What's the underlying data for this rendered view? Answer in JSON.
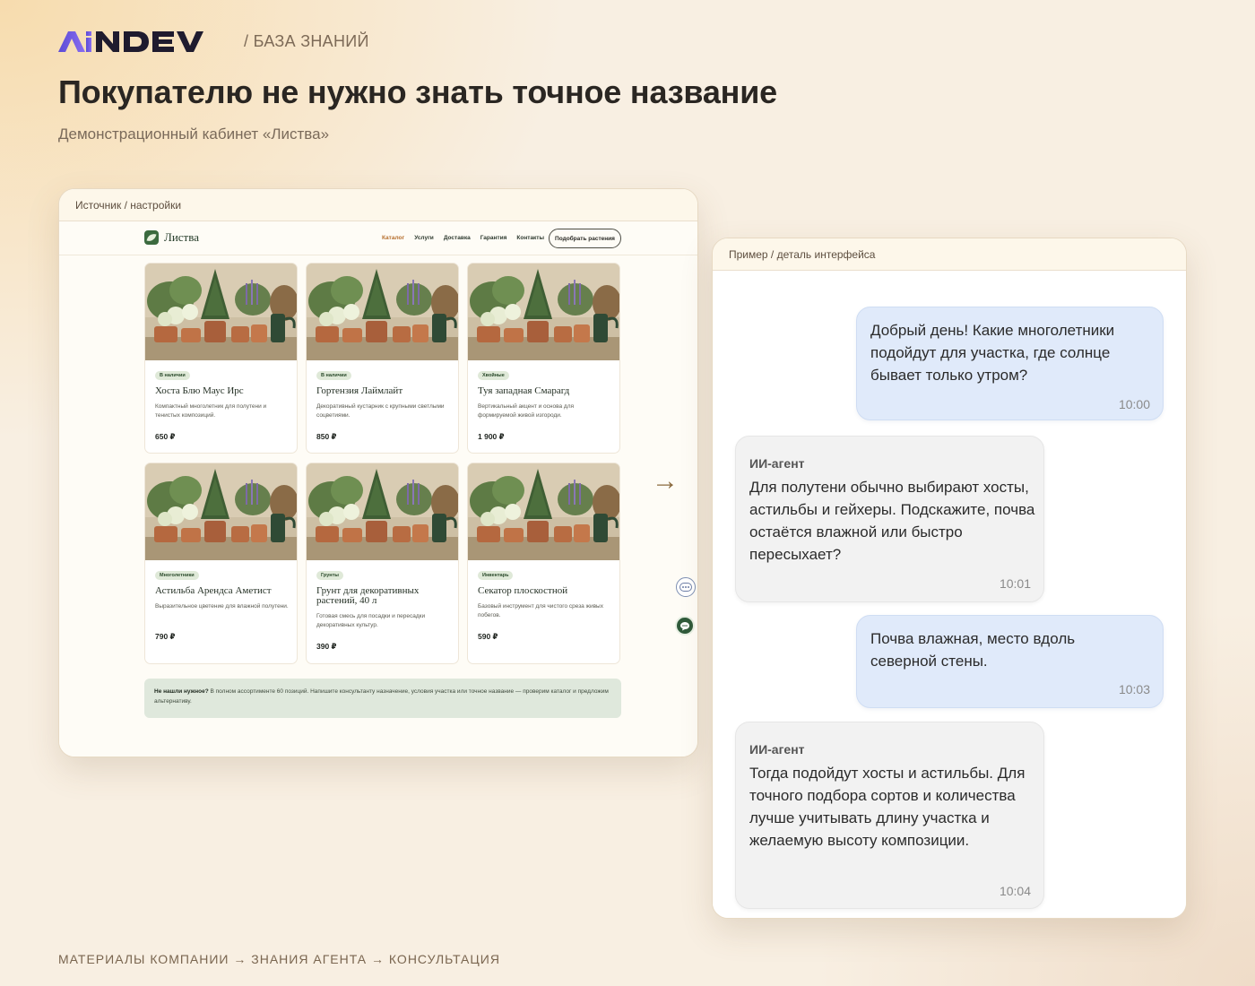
{
  "header": {
    "logo_text": "AiNDEV",
    "breadcrumb": "/ БАЗА ЗНАНИЙ",
    "title": "Покупателю не нужно знать точное название",
    "subtitle": "Демонстрационный кабинет «Листва»"
  },
  "source_panel": {
    "label": "Источник / настройки",
    "site": {
      "brand": "Листва",
      "nav": [
        "Каталог",
        "Услуги",
        "Доставка",
        "Гарантия",
        "Контакты"
      ],
      "cta": "Подобрать растения",
      "products": [
        {
          "badge": "В наличии",
          "title": "Хоста Блю Маус Ирс",
          "desc": "Компактный многолетник для полутени и тенистых композиций.",
          "price": "650 ₽"
        },
        {
          "badge": "В наличии",
          "title": "Гортензия Лаймлайт",
          "desc": "Декоративный кустарник с крупными светлыми соцветиями.",
          "price": "850 ₽"
        },
        {
          "badge": "Хвойные",
          "title": "Туя западная Смарагд",
          "desc": "Вертикальный акцент и основа для формируемой живой изгороди.",
          "price": "1 900 ₽"
        },
        {
          "badge": "Многолетники",
          "title": "Астильба Арендса Аметист",
          "desc": "Выразительное цветение для влажной полутени.",
          "price": "790 ₽"
        },
        {
          "badge": "Грунты",
          "title": "Грунт для декоративных растений, 40 л",
          "desc": "Готовая смесь для посадки и пересадки декоративных культур.",
          "price": "390 ₽"
        },
        {
          "badge": "Инвентарь",
          "title": "Секатор плоскостной",
          "desc": "Базовый инструмент для чистого среза живых побегов.",
          "price": "590 ₽"
        }
      ],
      "note_bold": "Не нашли нужное?",
      "note_text": " В полном ассортименте 60 позиций. Напишите консультанту назначение, условия участка или точное название — проверим каталог и предложим альтернативу."
    }
  },
  "arrow": "→",
  "chat_panel": {
    "label": "Пример / деталь интерфейса",
    "messages": [
      {
        "role": "user",
        "text": "Добрый день! Какие многолетники подойдут для участка, где солнце бывает только утром?",
        "time": "10:00"
      },
      {
        "role": "agent",
        "author": "ИИ-агент",
        "text": "Для полутени обычно выбирают хосты, астильбы и гейхеры. Подскажите, почва остаётся влажной или быстро пересыхает?",
        "time": "10:01"
      },
      {
        "role": "user",
        "text": "Почва влажная, место вдоль северной стены.",
        "time": "10:03"
      },
      {
        "role": "agent",
        "author": "ИИ-агент",
        "text": "Тогда подойдут хосты и астильбы. Для точного подбора сортов и количества лучше учитывать длину участка и желаемую высоту композиции.",
        "time": "10:04"
      }
    ]
  },
  "footer": "МАТЕРИАЛЫ КОМПАНИИ → ЗНАНИЯ АГЕНТА → КОНСУЛЬТАЦИЯ",
  "colors": {
    "brand_purple": "#6b4fd8",
    "brand_dark": "#1f1b2e",
    "user_bubble": "#e0eafa",
    "agent_bubble": "#f2f2f2",
    "badge_green": "#dfe9d8",
    "note_green": "#dfe8dc"
  },
  "icons": [
    "chat-widget-icon",
    "message-icon",
    "leaf-icon",
    "arrow-right-icon"
  ]
}
